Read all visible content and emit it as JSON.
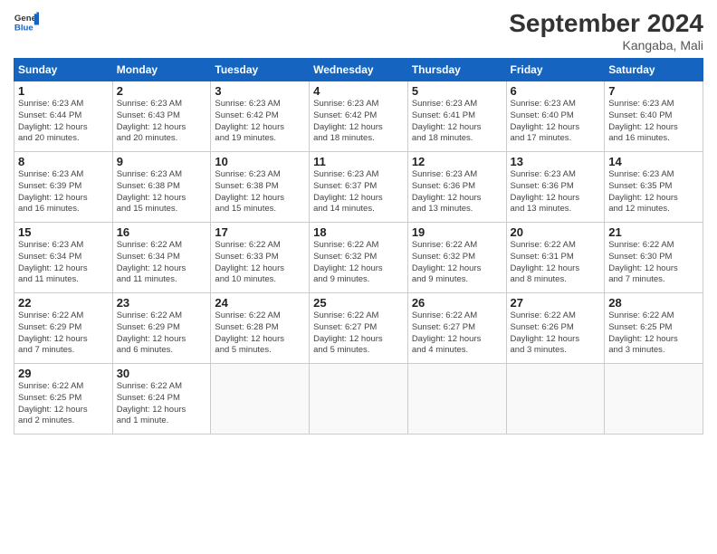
{
  "header": {
    "logo_line1": "General",
    "logo_line2": "Blue",
    "title": "September 2024",
    "subtitle": "Kangaba, Mali"
  },
  "days_of_week": [
    "Sunday",
    "Monday",
    "Tuesday",
    "Wednesday",
    "Thursday",
    "Friday",
    "Saturday"
  ],
  "weeks": [
    [
      {
        "day": "1",
        "info": "Sunrise: 6:23 AM\nSunset: 6:44 PM\nDaylight: 12 hours\nand 20 minutes."
      },
      {
        "day": "2",
        "info": "Sunrise: 6:23 AM\nSunset: 6:43 PM\nDaylight: 12 hours\nand 20 minutes."
      },
      {
        "day": "3",
        "info": "Sunrise: 6:23 AM\nSunset: 6:42 PM\nDaylight: 12 hours\nand 19 minutes."
      },
      {
        "day": "4",
        "info": "Sunrise: 6:23 AM\nSunset: 6:42 PM\nDaylight: 12 hours\nand 18 minutes."
      },
      {
        "day": "5",
        "info": "Sunrise: 6:23 AM\nSunset: 6:41 PM\nDaylight: 12 hours\nand 18 minutes."
      },
      {
        "day": "6",
        "info": "Sunrise: 6:23 AM\nSunset: 6:40 PM\nDaylight: 12 hours\nand 17 minutes."
      },
      {
        "day": "7",
        "info": "Sunrise: 6:23 AM\nSunset: 6:40 PM\nDaylight: 12 hours\nand 16 minutes."
      }
    ],
    [
      {
        "day": "8",
        "info": "Sunrise: 6:23 AM\nSunset: 6:39 PM\nDaylight: 12 hours\nand 16 minutes."
      },
      {
        "day": "9",
        "info": "Sunrise: 6:23 AM\nSunset: 6:38 PM\nDaylight: 12 hours\nand 15 minutes."
      },
      {
        "day": "10",
        "info": "Sunrise: 6:23 AM\nSunset: 6:38 PM\nDaylight: 12 hours\nand 15 minutes."
      },
      {
        "day": "11",
        "info": "Sunrise: 6:23 AM\nSunset: 6:37 PM\nDaylight: 12 hours\nand 14 minutes."
      },
      {
        "day": "12",
        "info": "Sunrise: 6:23 AM\nSunset: 6:36 PM\nDaylight: 12 hours\nand 13 minutes."
      },
      {
        "day": "13",
        "info": "Sunrise: 6:23 AM\nSunset: 6:36 PM\nDaylight: 12 hours\nand 13 minutes."
      },
      {
        "day": "14",
        "info": "Sunrise: 6:23 AM\nSunset: 6:35 PM\nDaylight: 12 hours\nand 12 minutes."
      }
    ],
    [
      {
        "day": "15",
        "info": "Sunrise: 6:23 AM\nSunset: 6:34 PM\nDaylight: 12 hours\nand 11 minutes."
      },
      {
        "day": "16",
        "info": "Sunrise: 6:22 AM\nSunset: 6:34 PM\nDaylight: 12 hours\nand 11 minutes."
      },
      {
        "day": "17",
        "info": "Sunrise: 6:22 AM\nSunset: 6:33 PM\nDaylight: 12 hours\nand 10 minutes."
      },
      {
        "day": "18",
        "info": "Sunrise: 6:22 AM\nSunset: 6:32 PM\nDaylight: 12 hours\nand 9 minutes."
      },
      {
        "day": "19",
        "info": "Sunrise: 6:22 AM\nSunset: 6:32 PM\nDaylight: 12 hours\nand 9 minutes."
      },
      {
        "day": "20",
        "info": "Sunrise: 6:22 AM\nSunset: 6:31 PM\nDaylight: 12 hours\nand 8 minutes."
      },
      {
        "day": "21",
        "info": "Sunrise: 6:22 AM\nSunset: 6:30 PM\nDaylight: 12 hours\nand 7 minutes."
      }
    ],
    [
      {
        "day": "22",
        "info": "Sunrise: 6:22 AM\nSunset: 6:29 PM\nDaylight: 12 hours\nand 7 minutes."
      },
      {
        "day": "23",
        "info": "Sunrise: 6:22 AM\nSunset: 6:29 PM\nDaylight: 12 hours\nand 6 minutes."
      },
      {
        "day": "24",
        "info": "Sunrise: 6:22 AM\nSunset: 6:28 PM\nDaylight: 12 hours\nand 5 minutes."
      },
      {
        "day": "25",
        "info": "Sunrise: 6:22 AM\nSunset: 6:27 PM\nDaylight: 12 hours\nand 5 minutes."
      },
      {
        "day": "26",
        "info": "Sunrise: 6:22 AM\nSunset: 6:27 PM\nDaylight: 12 hours\nand 4 minutes."
      },
      {
        "day": "27",
        "info": "Sunrise: 6:22 AM\nSunset: 6:26 PM\nDaylight: 12 hours\nand 3 minutes."
      },
      {
        "day": "28",
        "info": "Sunrise: 6:22 AM\nSunset: 6:25 PM\nDaylight: 12 hours\nand 3 minutes."
      }
    ],
    [
      {
        "day": "29",
        "info": "Sunrise: 6:22 AM\nSunset: 6:25 PM\nDaylight: 12 hours\nand 2 minutes."
      },
      {
        "day": "30",
        "info": "Sunrise: 6:22 AM\nSunset: 6:24 PM\nDaylight: 12 hours\nand 1 minute."
      },
      {
        "day": "",
        "info": ""
      },
      {
        "day": "",
        "info": ""
      },
      {
        "day": "",
        "info": ""
      },
      {
        "day": "",
        "info": ""
      },
      {
        "day": "",
        "info": ""
      }
    ]
  ]
}
